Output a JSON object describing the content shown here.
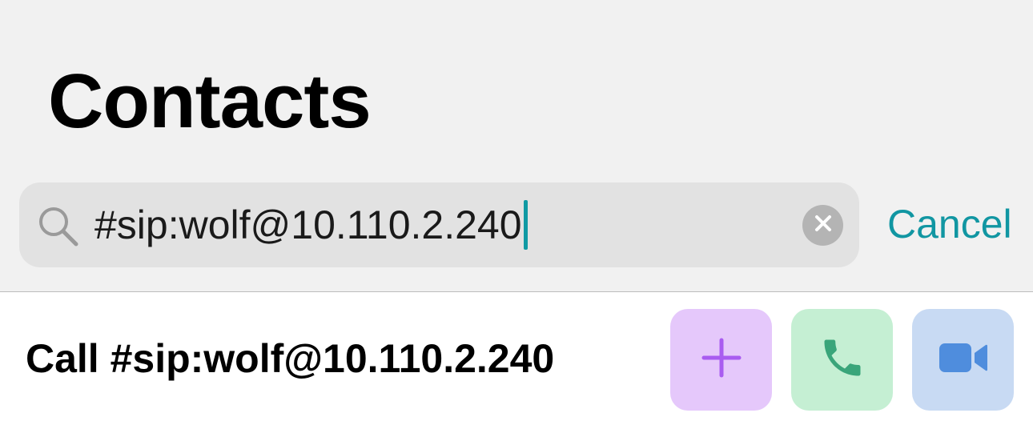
{
  "header": {
    "title": "Contacts"
  },
  "search": {
    "value": "#sip:wolf@10.110.2.240",
    "search_icon": "magnifier-icon",
    "clear_icon": "clear-x-icon",
    "cancel_label": "Cancel"
  },
  "result": {
    "label": "Call #sip:wolf@10.110.2.240",
    "actions": [
      {
        "name": "add-contact",
        "icon": "plus-icon",
        "bg": "#e5c8fb",
        "fg": "#a95cf0"
      },
      {
        "name": "audio-call",
        "icon": "phone-icon",
        "bg": "#c5efd3",
        "fg": "#3aa57a"
      },
      {
        "name": "video-call",
        "icon": "video-camera-icon",
        "bg": "#c8daf3",
        "fg": "#4f8ddd"
      }
    ]
  },
  "colors": {
    "accent": "#1196a2",
    "caret": "#109aa3",
    "header_bg": "#f1f1f1",
    "search_bg": "#e2e2e2",
    "row_bg": "#ffffff"
  }
}
